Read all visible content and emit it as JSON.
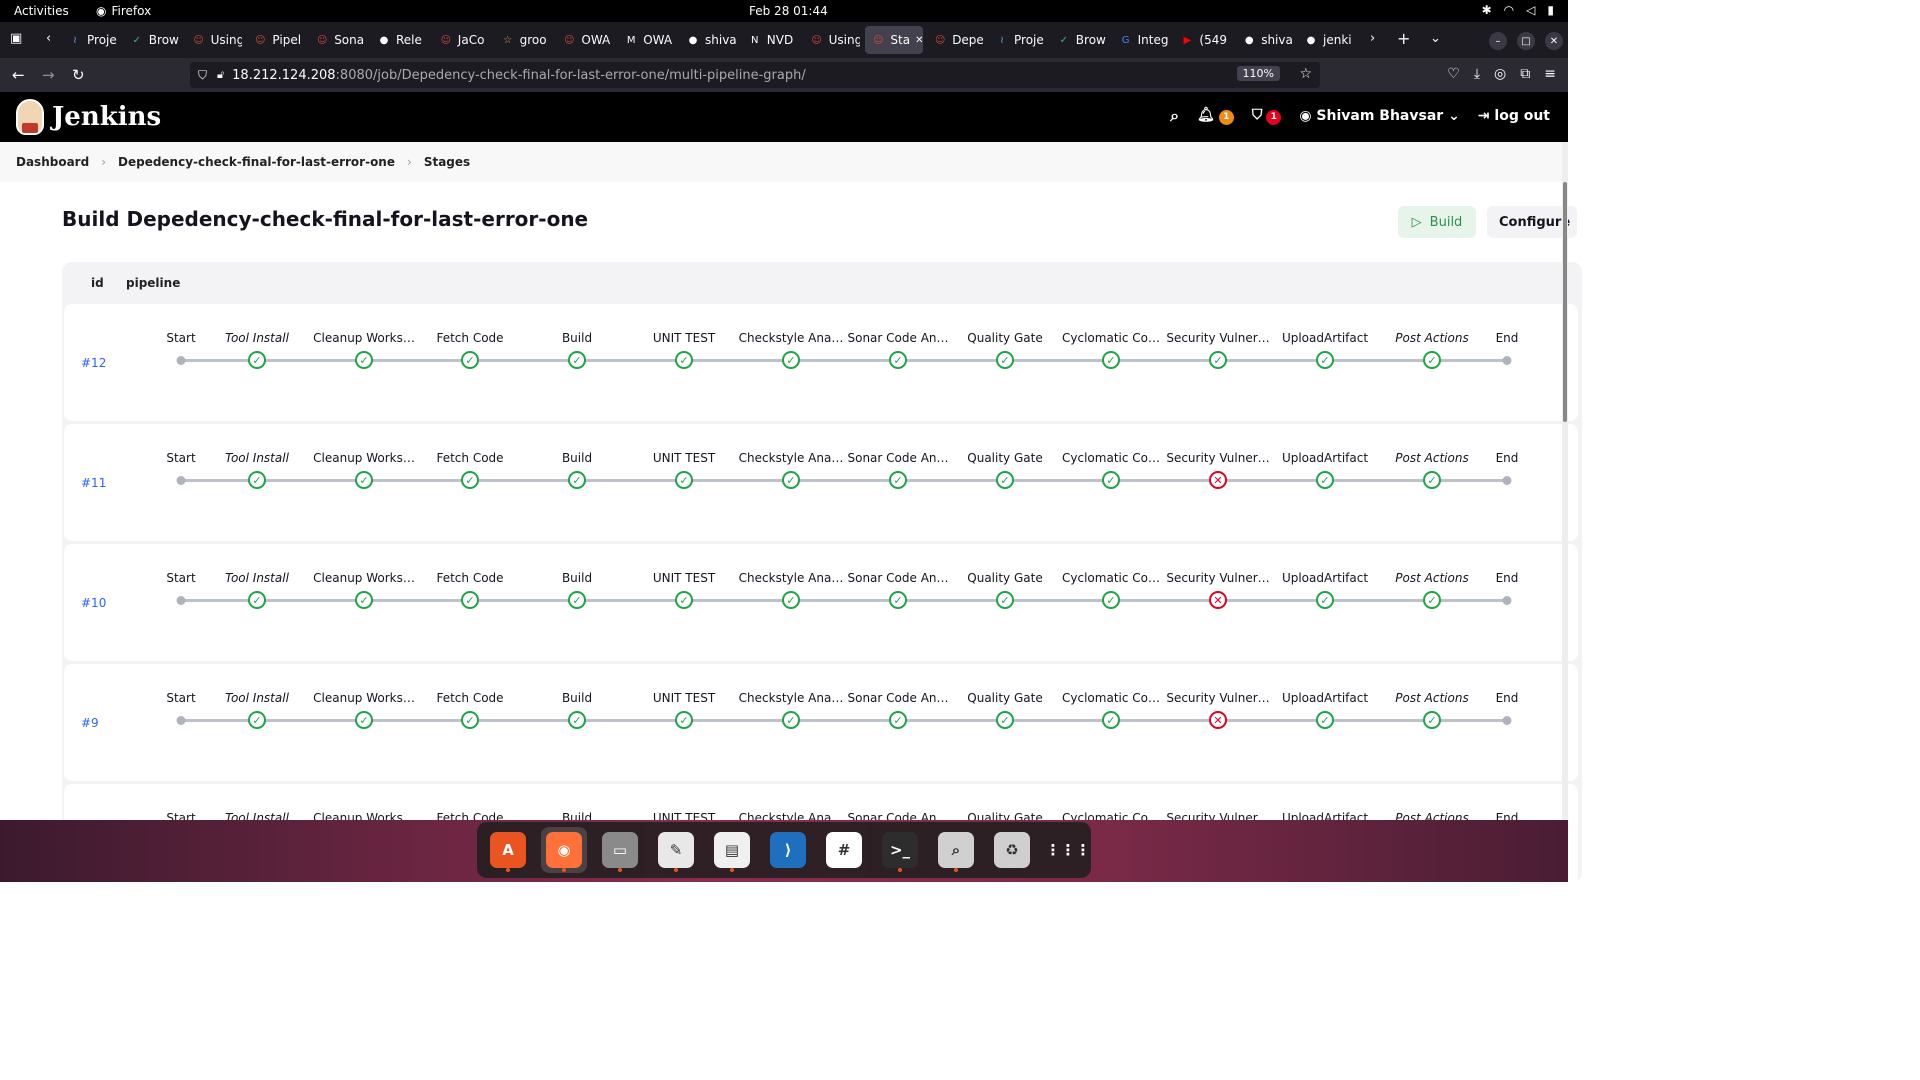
{
  "system": {
    "activities": "Activities",
    "app_name": "Firefox",
    "clock": "Feb 28  01:44"
  },
  "tabs": [
    {
      "label": "Proje",
      "icon": "ripple-icon",
      "color": "#6ea4d8"
    },
    {
      "label": "Brow",
      "icon": "check-icon",
      "color": "#46b06f"
    },
    {
      "label": "Using",
      "icon": "jenkins-icon",
      "color": "#d24939"
    },
    {
      "label": "Pipel",
      "icon": "jenkins-icon",
      "color": "#d24939"
    },
    {
      "label": "Sona",
      "icon": "jenkins-icon",
      "color": "#d24939"
    },
    {
      "label": "Rele",
      "icon": "github-icon",
      "color": "#ffffff"
    },
    {
      "label": "JaCo",
      "icon": "jenkins-icon",
      "color": "#d24939"
    },
    {
      "label": "groo",
      "icon": "groovy-icon",
      "color": "#e0a24a"
    },
    {
      "label": "OWA",
      "icon": "jenkins-icon",
      "color": "#d24939"
    },
    {
      "label": "OWA",
      "icon": "medium-icon",
      "color": "#ffffff"
    },
    {
      "label": "shiva",
      "icon": "github-icon",
      "color": "#ffffff"
    },
    {
      "label": "NVD",
      "icon": "nvd-icon",
      "color": "#ffffff"
    },
    {
      "label": "Using",
      "icon": "jenkins-icon",
      "color": "#d24939"
    },
    {
      "label": "Sta",
      "icon": "jenkins-icon",
      "color": "#d24939",
      "active": true
    },
    {
      "label": "Depe",
      "icon": "jenkins-icon",
      "color": "#d24939"
    },
    {
      "label": "Proje",
      "icon": "ripple-icon",
      "color": "#6ea4d8"
    },
    {
      "label": "Brow",
      "icon": "check-icon",
      "color": "#46b06f"
    },
    {
      "label": "Integ",
      "icon": "google-icon",
      "color": "#4285f4"
    },
    {
      "label": "(549",
      "icon": "youtube-icon",
      "color": "#ff0000"
    },
    {
      "label": "shiva",
      "icon": "github-icon",
      "color": "#ffffff"
    },
    {
      "label": "jenki",
      "icon": "github-icon",
      "color": "#ffffff"
    }
  ],
  "urlbar": {
    "host": "18.212.124.208",
    "path": ":8080/job/Depedency-check-final-for-last-error-one/multi-pipeline-graph/",
    "zoom": "110%"
  },
  "jenkins": {
    "title": "Jenkins",
    "notifications_count": "1",
    "security_count": "1",
    "user": "Shivam Bhavsar",
    "logout": "log out"
  },
  "breadcrumb": {
    "dashboard": "Dashboard",
    "job": "Depedency-check-final-for-last-error-one",
    "stages": "Stages"
  },
  "page": {
    "title": "Build Depedency-check-final-for-last-error-one",
    "build_button": "Build",
    "configure_button": "Configure"
  },
  "table": {
    "col_id": "id",
    "col_pipeline": "pipeline"
  },
  "stages": [
    {
      "label": "Start",
      "kind": "dot"
    },
    {
      "label": "Tool Install",
      "kind": "node",
      "italic": true
    },
    {
      "label": "Cleanup Works…",
      "kind": "node"
    },
    {
      "label": "Fetch Code",
      "kind": "node"
    },
    {
      "label": "Build",
      "kind": "node"
    },
    {
      "label": "UNIT TEST",
      "kind": "node"
    },
    {
      "label": "Checkstyle Ana…",
      "kind": "node"
    },
    {
      "label": "Sonar Code An…",
      "kind": "node"
    },
    {
      "label": "Quality Gate",
      "kind": "node"
    },
    {
      "label": "Cyclomatic Co…",
      "kind": "node"
    },
    {
      "label": "Security Vulner…",
      "kind": "node"
    },
    {
      "label": "UploadArtifact",
      "kind": "node"
    },
    {
      "label": "Post Actions",
      "kind": "node",
      "italic": true
    },
    {
      "label": "End",
      "kind": "dot"
    }
  ],
  "runs": [
    {
      "id": "#12",
      "statuses": [
        "dot",
        "ok",
        "ok",
        "ok",
        "ok",
        "ok",
        "ok",
        "ok",
        "ok",
        "ok",
        "ok",
        "ok",
        "ok",
        "dot"
      ]
    },
    {
      "id": "#11",
      "statuses": [
        "dot",
        "ok",
        "ok",
        "ok",
        "ok",
        "ok",
        "ok",
        "ok",
        "ok",
        "ok",
        "fail",
        "ok",
        "ok",
        "dot"
      ]
    },
    {
      "id": "#10",
      "statuses": [
        "dot",
        "ok",
        "ok",
        "ok",
        "ok",
        "ok",
        "ok",
        "ok",
        "ok",
        "ok",
        "fail",
        "ok",
        "ok",
        "dot"
      ]
    },
    {
      "id": "#9",
      "statuses": [
        "dot",
        "ok",
        "ok",
        "ok",
        "ok",
        "ok",
        "ok",
        "ok",
        "ok",
        "ok",
        "fail",
        "ok",
        "ok",
        "dot"
      ]
    },
    {
      "id": "",
      "statuses": []
    }
  ],
  "dock": [
    {
      "name": "app-center-icon",
      "glyph": "A",
      "bg": "#e95420"
    },
    {
      "name": "firefox-icon",
      "glyph": "◉",
      "bg": "#ff7139",
      "active": true
    },
    {
      "name": "files-icon",
      "glyph": "▭",
      "bg": "#8a8a8a"
    },
    {
      "name": "text-editor-icon",
      "glyph": "✎",
      "bg": "#e8e8e8"
    },
    {
      "name": "document-viewer-icon",
      "glyph": "▤",
      "bg": "#f0f0f0"
    },
    {
      "name": "vscode-icon",
      "glyph": "⟩",
      "bg": "#1f6fbf"
    },
    {
      "name": "slack-icon",
      "glyph": "#",
      "bg": "#ffffff"
    },
    {
      "name": "terminal-icon",
      "glyph": ">_",
      "bg": "#2d2d2d"
    },
    {
      "name": "image-viewer-icon",
      "glyph": "⌕",
      "bg": "#d0d0d0"
    },
    {
      "name": "trash-icon",
      "glyph": "♻",
      "bg": "#cfcfcf"
    },
    {
      "name": "app-grid-icon",
      "glyph": "⋮⋮⋮",
      "bg": "transparent"
    }
  ],
  "colors": {
    "success": "#1ea446",
    "failure": "#e6001f",
    "link": "#2962ff",
    "build_green": "#2c8f4b"
  }
}
